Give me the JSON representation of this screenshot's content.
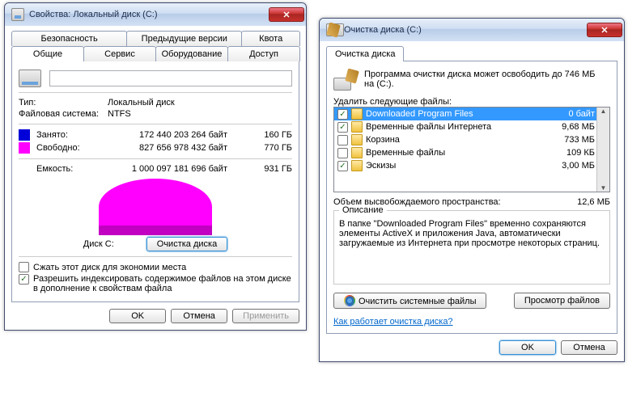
{
  "props": {
    "title": "Свойства: Локальный диск (C:)",
    "tabsTop": [
      "Безопасность",
      "Предыдущие версии",
      "Квота"
    ],
    "tabsBot": [
      "Общие",
      "Сервис",
      "Оборудование",
      "Доступ"
    ],
    "typeLbl": "Тип:",
    "typeVal": "Локальный диск",
    "fsLbl": "Файловая система:",
    "fsVal": "NTFS",
    "usedLbl": "Занято:",
    "usedBytes": "172 440 203 264 байт",
    "usedH": "160 ГБ",
    "freeLbl": "Свободно:",
    "freeBytes": "827 656 978 432 байт",
    "freeH": "770 ГБ",
    "capLbl": "Емкость:",
    "capBytes": "1 000 097 181 696 байт",
    "capH": "931 ГБ",
    "diskCaption": "Диск C:",
    "cleanupBtn": "Очистка диска",
    "compress": "Сжать этот диск для экономии места",
    "index": "Разрешить индексировать содержимое файлов на этом диске в дополнение к свойствам файла",
    "ok": "OK",
    "cancel": "Отмена",
    "apply": "Применить",
    "usedColor": "#0000d8",
    "freeColor": "#ff00ff"
  },
  "clean": {
    "title": "Очистка диска  (C:)",
    "tab": "Очистка диска",
    "intro1": "Программа очистки диска может освободить до 746 МБ",
    "intro2": "на  (C:).",
    "listLbl": "Удалить следующие файлы:",
    "items": [
      {
        "checked": true,
        "label": "Downloaded Program Files",
        "size": "0 байт",
        "sel": true
      },
      {
        "checked": true,
        "label": "Временные файлы Интернета",
        "size": "9,68 МБ"
      },
      {
        "checked": false,
        "label": "Корзина",
        "size": "733 МБ"
      },
      {
        "checked": false,
        "label": "Временные файлы",
        "size": "109 КБ"
      },
      {
        "checked": true,
        "label": "Эскизы",
        "size": "3,00 МБ"
      }
    ],
    "totalLbl": "Объем высвобождаемого пространства:",
    "totalVal": "12,6 МБ",
    "descLegend": "Описание",
    "descText": "В папке \"Downloaded Program Files\" временно сохраняются элементы ActiveX и приложения Java, автоматически загружаемые из Интернета при просмотре некоторых страниц.",
    "cleanSys": "Очистить системные файлы",
    "viewFiles": "Просмотр файлов",
    "howLink": "Как работает очистка диска?",
    "ok": "OK",
    "cancel": "Отмена"
  }
}
